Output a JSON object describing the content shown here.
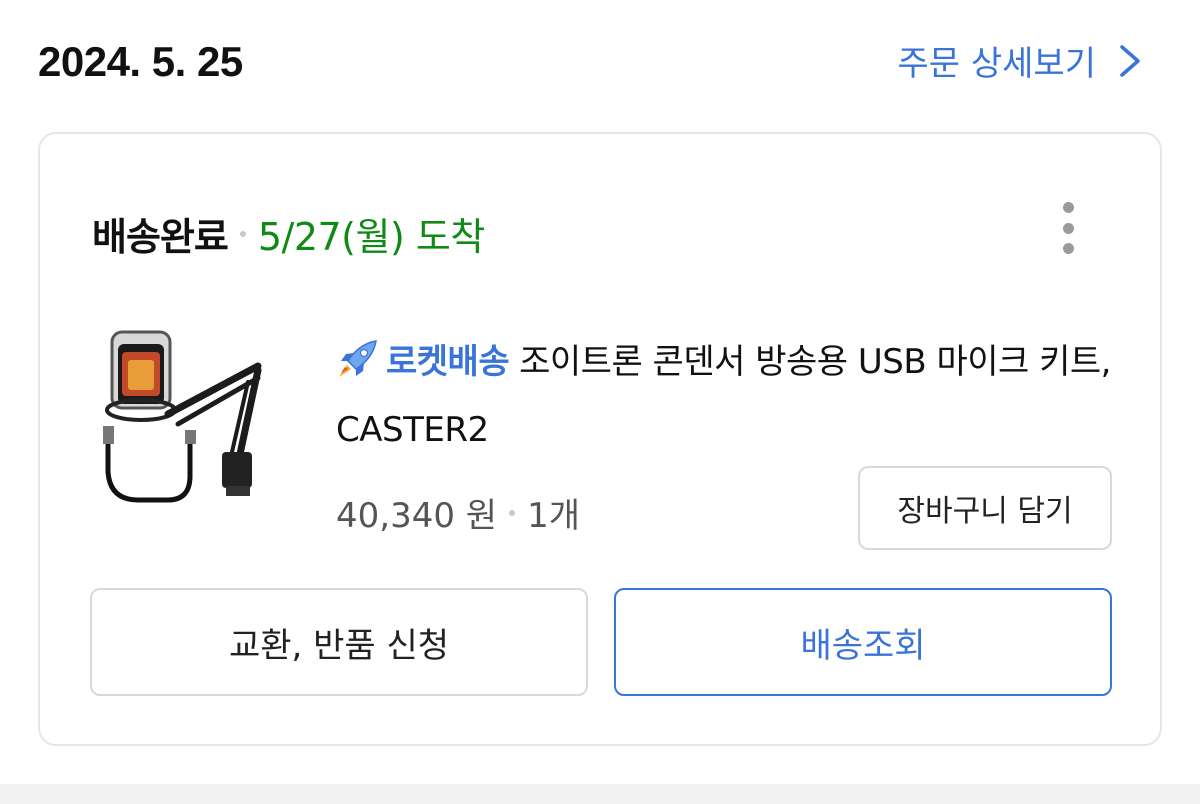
{
  "order": {
    "date": "2024. 5. 25",
    "detail_link": "주문 상세보기",
    "chevron_icon": "chevron-right-icon"
  },
  "shipment": {
    "status": "배송완료",
    "arrival": "5/27(월) 도착",
    "more_icon": "more-vertical-icon"
  },
  "product": {
    "badge_icon": "rocket-icon",
    "badge_label": "로켓배송",
    "name": "조이트론 콘덴서 방송용 USB 마이크 키트, CASTER2",
    "price": "40,340 원",
    "quantity": "1개",
    "add_to_cart": "장바구니 담기"
  },
  "actions": {
    "return": "교환, 반품 신청",
    "track": "배송조회"
  },
  "colors": {
    "accent": "#3a74d8",
    "arrival_green": "#108a17",
    "border": "#d9d9d9"
  }
}
